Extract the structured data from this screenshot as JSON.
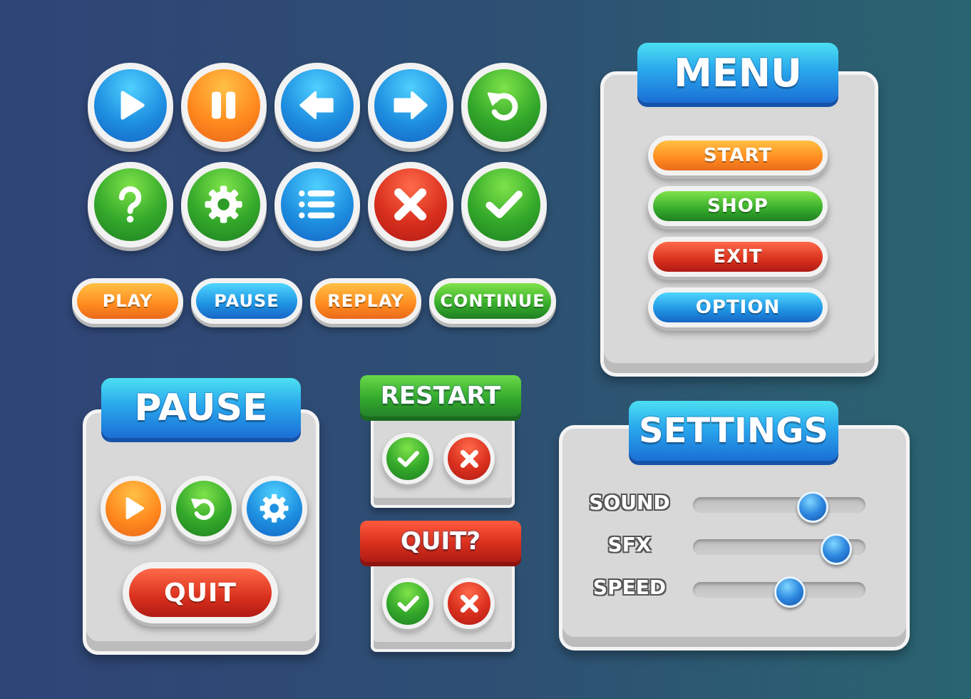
{
  "pills": {
    "play": "PLAY",
    "pause": "PAUSE",
    "replay": "REPLAY",
    "continue": "CONTINUE"
  },
  "menu": {
    "title": "MENU",
    "start": "START",
    "shop": "SHOP",
    "exit": "EXIT",
    "option": "OPTION"
  },
  "pause_panel": {
    "title": "PAUSE",
    "quit": "QUIT"
  },
  "restart_dialog": {
    "title": "RESTART"
  },
  "quit_dialog": {
    "title": "QUIT?"
  },
  "settings": {
    "title": "SETTINGS",
    "sliders": [
      {
        "label": "SOUND",
        "value": 0.68
      },
      {
        "label": "SFX",
        "value": 0.82
      },
      {
        "label": "SPEED",
        "value": 0.55
      }
    ]
  },
  "colors": {
    "blue": "#1e8fe0",
    "orange": "#ff8a1e",
    "green": "#33a82a",
    "red": "#d9301e",
    "panel": "#d8d8d8"
  },
  "icons": [
    "play-icon",
    "pause-icon",
    "arrow-left-icon",
    "arrow-right-icon",
    "replay-icon",
    "question-icon",
    "gear-icon",
    "list-icon",
    "close-icon",
    "check-icon"
  ]
}
